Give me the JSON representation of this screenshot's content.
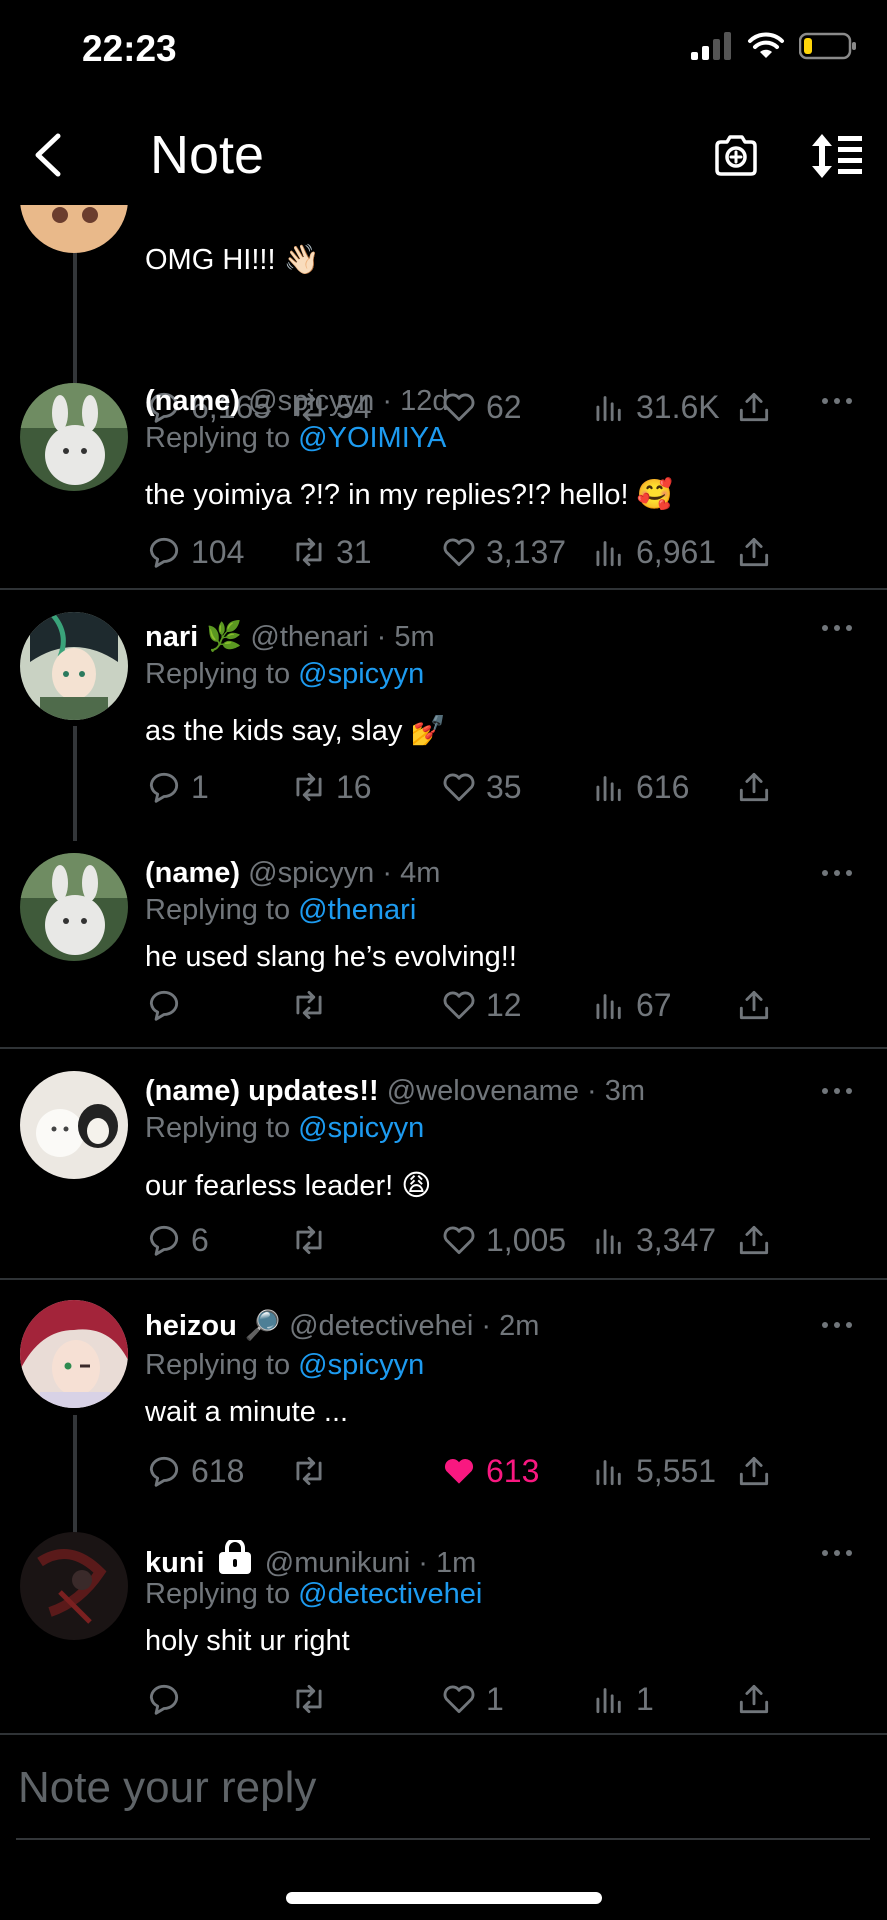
{
  "status_bar": {
    "time": "22:23"
  },
  "header": {
    "title": "Note"
  },
  "tweets": [
    {
      "text": "OMG HI!!! 👋🏻",
      "replies": "6,165",
      "retweets": "54",
      "likes": "62",
      "views": "31.6K"
    },
    {
      "name": "(name)",
      "handle": "@spicyyn",
      "time": "12d",
      "replying_label": "Replying to",
      "replying_to": "@YOIMIYA",
      "text": "the yoimiya ?!? in my replies?!? hello! 🥰",
      "replies": "104",
      "retweets": "31",
      "likes": "3,137",
      "views": "6,961"
    },
    {
      "name": "nari",
      "badge": "🌿",
      "handle": "@thenari",
      "time": "5m",
      "replying_label": "Replying to",
      "replying_to": "@spicyyn",
      "text": "as the kids say, slay 💅",
      "replies": "1",
      "retweets": "16",
      "likes": "35",
      "views": "616"
    },
    {
      "name": "(name)",
      "handle": "@spicyyn",
      "time": "4m",
      "replying_label": "Replying to",
      "replying_to": "@thenari",
      "text": "he used slang he’s evolving!!",
      "replies": "",
      "retweets": "",
      "likes": "12",
      "views": "67"
    },
    {
      "name": "(name) updates!!",
      "handle": "@welovename",
      "time": "3m",
      "replying_label": "Replying to",
      "replying_to": "@spicyyn",
      "text": "our fearless leader! 😩",
      "replies": "6",
      "retweets": "",
      "likes": "1,005",
      "views": "3,347"
    },
    {
      "name": "heizou",
      "badge": "🔎",
      "handle": "@detectivehei",
      "time": "2m",
      "replying_label": "Replying to",
      "replying_to": "@spicyyn",
      "text": "wait a minute ...",
      "replies": "618",
      "retweets": "",
      "likes": "613",
      "views": "5,551",
      "liked": true
    },
    {
      "name": "kuni",
      "handle": "@munikuni",
      "time": "1m",
      "locked": true,
      "replying_label": "Replying to",
      "replying_to": "@detectivehei",
      "text": "holy shit ur right",
      "replies": "",
      "retweets": "",
      "likes": "1",
      "views": "1"
    }
  ],
  "composer": {
    "placeholder": "Note your reply"
  },
  "colors": {
    "accent": "#1d9bf0",
    "like": "#f91880",
    "muted": "#71767b",
    "background": "#000000"
  },
  "icons": [
    "back-icon",
    "camera-icon",
    "sort-icon",
    "reply-icon",
    "retweet-icon",
    "like-icon",
    "views-icon",
    "share-icon",
    "more-icon",
    "lock-icon"
  ]
}
